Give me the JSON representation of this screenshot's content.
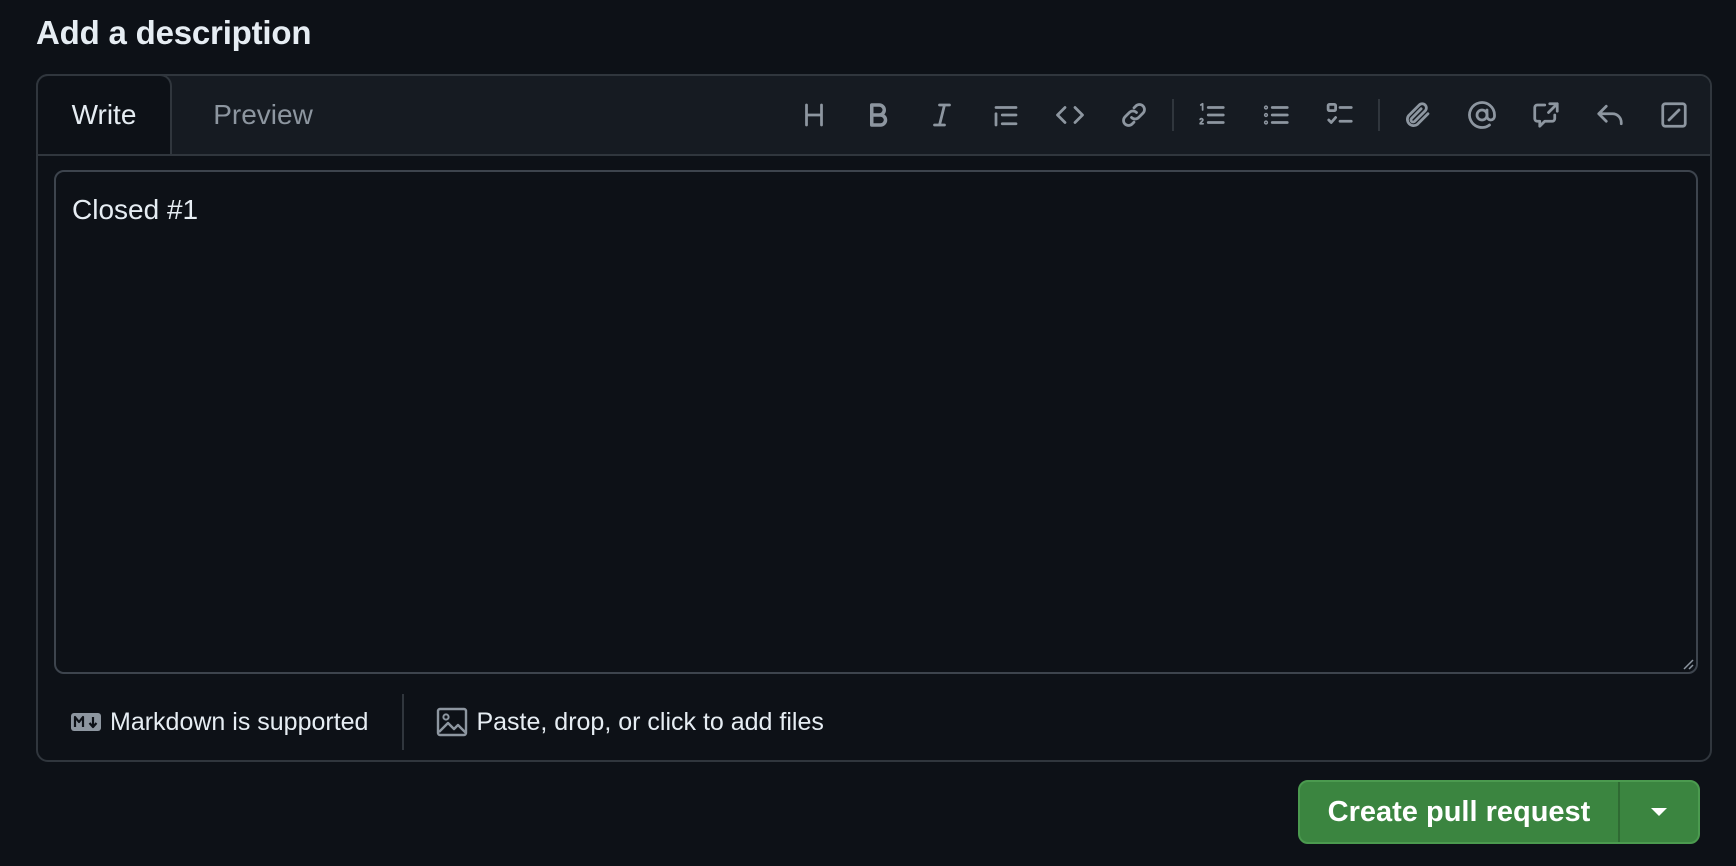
{
  "section": {
    "title": "Add a description"
  },
  "editor": {
    "tabs": [
      {
        "label": "Write",
        "active": true
      },
      {
        "label": "Preview",
        "active": false
      }
    ],
    "toolbar_icons": [
      "heading-icon",
      "bold-icon",
      "italic-icon",
      "quote-icon",
      "code-icon",
      "link-icon",
      "numbered-list-icon",
      "unordered-list-icon",
      "task-list-icon",
      "attach-icon",
      "mention-icon",
      "cross-reference-icon",
      "saved-reply-icon",
      "fullscreen-icon"
    ],
    "body_text": "Closed #1",
    "footer": {
      "markdown_label": "Markdown is supported",
      "files_label": "Paste, drop, or click to add files"
    }
  },
  "actions": {
    "create_label": "Create pull request"
  },
  "colors": {
    "background": "#0d1117",
    "primary_button": "#3b8540",
    "border": "#30363d",
    "muted_text": "#8d96a0"
  }
}
